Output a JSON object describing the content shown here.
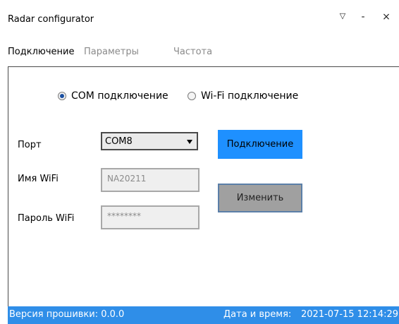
{
  "window": {
    "title": "Radar configurator",
    "menu_glyph": "▽",
    "minimize_glyph": "-",
    "close_glyph": "×"
  },
  "tabs": [
    {
      "label": "Подключение",
      "active": true
    },
    {
      "label": "Параметры",
      "active": false
    },
    {
      "label": "Частота",
      "active": false
    }
  ],
  "connection_mode": {
    "com_label": "COM подключение",
    "wifi_label": "Wi-Fi подключение",
    "selected": "com"
  },
  "form": {
    "port_label": "Порт",
    "port_value": "COM8",
    "wifi_name_label": "Имя WiFi",
    "wifi_name_value": "NA20211",
    "wifi_password_label": "Пароль WiFi",
    "wifi_password_value": "********"
  },
  "buttons": {
    "connect_label": "Подключение",
    "change_label": "Изменить"
  },
  "status": {
    "firmware_label": "Версия прошивки: 0.0.0",
    "datetime_label": "Дата и время:",
    "datetime_value": "2021-07-15 12:14:29"
  },
  "colors": {
    "accent": "#1e90ff",
    "statusbar": "#2f8ee8"
  }
}
